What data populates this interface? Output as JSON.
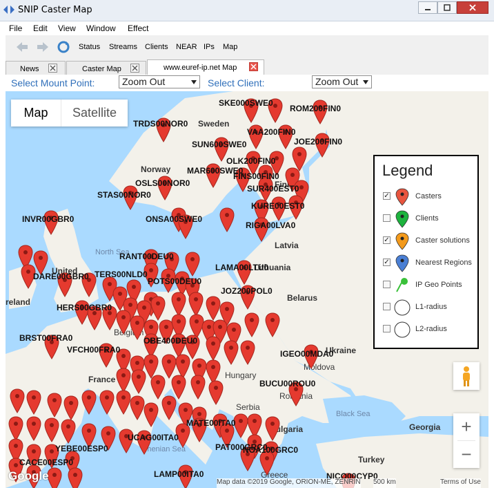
{
  "window": {
    "title": "SNIP Caster Map"
  },
  "menu": [
    "File",
    "Edit",
    "View",
    "Window",
    "Effect"
  ],
  "toolbar": {
    "status": "Status",
    "streams": "Streams",
    "clients": "Clients",
    "near": "NEAR",
    "ips": "IPs",
    "map": "Map"
  },
  "tabs": [
    {
      "label": "News"
    },
    {
      "label": "Caster Map"
    },
    {
      "label": "www.euref-ip.net Map"
    }
  ],
  "selectors": {
    "mount_label": "Select Mount Point:",
    "mount_value": "Zoom Out",
    "client_label": "Select Client:",
    "client_value": "Zoom Out"
  },
  "map": {
    "type_map": "Map",
    "type_satellite": "Satellite",
    "zoom_in": "+",
    "zoom_out": "−",
    "google": "Google",
    "map_data": "Map data ©2019 Google, ORION-ME, ZENRIN",
    "scale": "500 km",
    "terms": "Terms of Use",
    "colors": {
      "water": "#aadaff",
      "land": "#f3f1ea",
      "pin": "#e53a2f"
    }
  },
  "places": {
    "sweden": "Sweden",
    "norway": "Norway",
    "finland": "Finland",
    "north_sea": "North Sea",
    "united": "United",
    "ireland": "reland",
    "latvia": "Latvia",
    "lithuania": "Lithuania",
    "belarus": "Belarus",
    "belgium": "Belgium",
    "france": "France",
    "hungary": "Hungary",
    "ukraine": "Ukraine",
    "serbia": "Serbia",
    "bulgaria": "Bulgaria",
    "black_sea": "Black Sea",
    "georgia": "Georgia",
    "turkey": "Turkey",
    "tyrrhenian": "rrhenian Sea",
    "romania": "Romania",
    "moldova": "Moldova",
    "greece": "Greece"
  },
  "stations": [
    "SKE000SWE0",
    "ROM200FIN0",
    "TRDS00NOR0",
    "VAA200FIN0",
    "JOE200FIN0",
    "SUN600SWE0",
    "OLK200FIN0",
    "MAR600SWE0",
    "FINS00FIN0",
    "SUR400EST0",
    "OSLS00NOR0",
    "STAS00NOR0",
    "KURE00EST0",
    "ONSA00SWE0",
    "RIGA00LVA0",
    "INVR00GBR0",
    "RANT00DEU0",
    "LAMA00LTU0",
    "DARE00GBR0",
    "TERS00NLD0",
    "HERS00GBR0",
    "POTS00DEU0",
    "JOZ200POL0",
    "BRST00FRA0",
    "OBE400DEU0",
    "VFCH00FRA0",
    "IGEO00MDA0",
    "BUCU00ROU0",
    "UCAG00ITA0",
    "MATE00ITA0",
    "PAT000GRC0",
    "NOA100GRC0",
    "LAMP00ITA0",
    "NICO00CYP0",
    "YEBE00ESP0",
    "CACE00ESP0"
  ],
  "legend": {
    "title": "Legend",
    "items": [
      {
        "label": "Casters",
        "checked": true,
        "icon": "red-pin-icon"
      },
      {
        "label": "Clients",
        "checked": false,
        "icon": "green-pin-icon"
      },
      {
        "label": "Caster solutions",
        "checked": true,
        "icon": "orange-pin-icon"
      },
      {
        "label": "Nearest Regions",
        "checked": true,
        "icon": "blue-pin-icon"
      },
      {
        "label": "IP Geo Points",
        "checked": false,
        "icon": "green-pushpin-icon"
      },
      {
        "label": "L1-radius",
        "checked": false,
        "icon": "circle-icon"
      },
      {
        "label": "L2-radius",
        "checked": false,
        "icon": "circle-icon"
      }
    ]
  }
}
